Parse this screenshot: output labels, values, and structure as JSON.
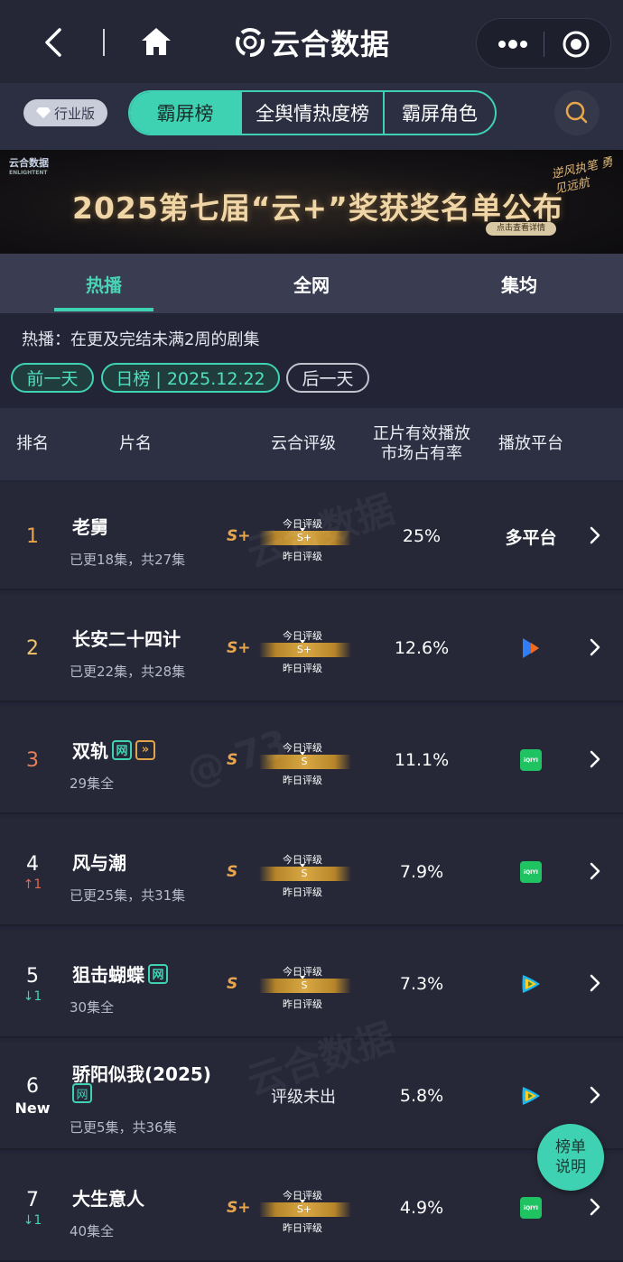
{
  "header": {
    "title": "云合数据"
  },
  "top_tabs": {
    "pro_badge": "行业版",
    "tabs": [
      "霸屏榜",
      "全舆情热度榜",
      "霸屏角色"
    ],
    "active": "霸屏榜"
  },
  "banner": {
    "logo_text": "云合数据",
    "logo_sub": "ENLIGHTENT",
    "headline": "2025第七届“云+”奖获奖名单公布",
    "button": "点击查看详情",
    "slogan": "逆风执笔 勇见远航"
  },
  "sub_tabs": [
    "热播",
    "全网",
    "集均"
  ],
  "description": "热播：在更及完结未满2周的剧集",
  "date_nav": {
    "prev": "前一天",
    "current": "日榜 | 2025.12.22",
    "next": "后一天"
  },
  "table_headers": {
    "rank": "排名",
    "title": "片名",
    "grade": "云合评级",
    "share": "正片有效播放\n市场占有率",
    "platform": "播放平台"
  },
  "grade_labels": {
    "today": "今日评级",
    "yesterday": "昨日评级"
  },
  "rows": [
    {
      "rank": "1",
      "change": "",
      "title": "老舅",
      "tags": [],
      "episodes": "已更18集，共27集",
      "grade": "S+",
      "grade_today": "S+",
      "share": "25%",
      "platform": "多平台",
      "platform_icon": ""
    },
    {
      "rank": "2",
      "change": "",
      "title": "长安二十四计",
      "tags": [],
      "episodes": "已更22集，共28集",
      "grade": "S+",
      "grade_today": "S+",
      "share": "12.6%",
      "platform": "",
      "platform_icon": "youku-icon"
    },
    {
      "rank": "3",
      "change": "",
      "title": "双轨",
      "tags": [
        "网",
        "»"
      ],
      "episodes": "29集全",
      "grade": "S",
      "grade_today": "S",
      "share": "11.1%",
      "platform": "",
      "platform_icon": "iqiyi-icon"
    },
    {
      "rank": "4",
      "change": "↑1",
      "title": "风与潮",
      "tags": [],
      "episodes": "已更25集，共31集",
      "grade": "S",
      "grade_today": "S",
      "share": "7.9%",
      "platform": "",
      "platform_icon": "iqiyi-icon"
    },
    {
      "rank": "5",
      "change": "↓1",
      "title": "狙击蝴蝶",
      "tags": [
        "网"
      ],
      "episodes": "30集全",
      "grade": "S",
      "grade_today": "S",
      "share": "7.3%",
      "platform": "",
      "platform_icon": "tencent-video-icon"
    },
    {
      "rank": "6",
      "change": "New",
      "title": "骄阳似我(2025)",
      "tags": [
        "网"
      ],
      "episodes": "已更5集，共36集",
      "grade": "",
      "grade_today": "",
      "grade_na": "评级未出",
      "share": "5.8%",
      "platform": "",
      "platform_icon": "tencent-video-icon"
    },
    {
      "rank": "7",
      "change": "↓1",
      "title": "大生意人",
      "tags": [],
      "episodes": "40集全",
      "grade": "S+",
      "grade_today": "S+",
      "share": "4.9%",
      "platform": "",
      "platform_icon": "iqiyi-icon"
    }
  ],
  "iqiyi_text": "iQIYI",
  "watermark": {
    "brand": "云合数据",
    "brand_sub": "ENLIGHTENT",
    "id": "@ 73"
  },
  "fab": {
    "label": "榜单说明"
  },
  "colors": {
    "accent": "#3fd2b2",
    "gold": "#e9a64c",
    "bg": "#232536",
    "up": "#e4664e"
  }
}
